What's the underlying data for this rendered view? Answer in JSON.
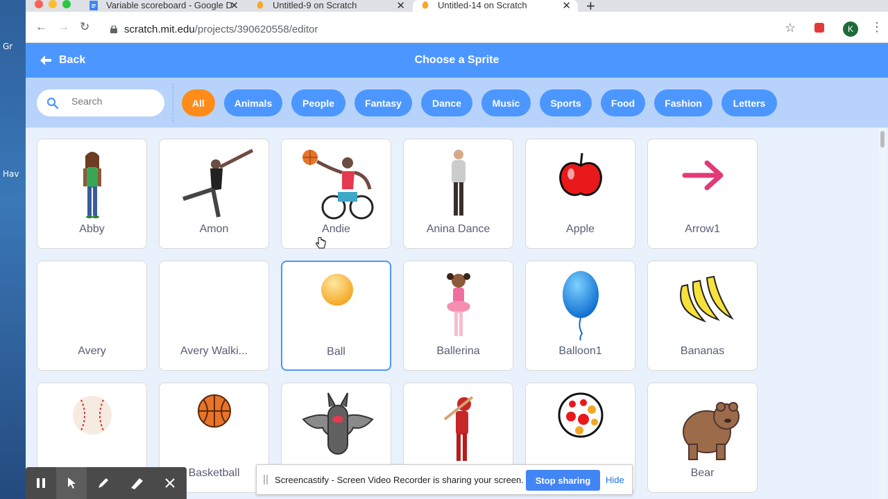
{
  "desktop": {
    "labels": [
      "Gr",
      "Hav"
    ]
  },
  "tabs": [
    {
      "title": "Variable scoreboard - Google D",
      "icon": "google-docs-icon"
    },
    {
      "title": "Untitled-9 on Scratch",
      "icon": "scratch-icon"
    },
    {
      "title": "Untitled-14 on Scratch",
      "icon": "scratch-icon",
      "active": true
    }
  ],
  "address": {
    "host": "scratch.mit.edu",
    "path": "/projects/390620558/editor"
  },
  "profile_initial": "K",
  "modal": {
    "back_label": "Back",
    "title": "Choose a Sprite",
    "search_placeholder": "Search",
    "categories": [
      "All",
      "Animals",
      "People",
      "Fantasy",
      "Dance",
      "Music",
      "Sports",
      "Food",
      "Fashion",
      "Letters"
    ],
    "active_category": "All"
  },
  "sprites": [
    {
      "name": "Abby",
      "icon": "girl-icon"
    },
    {
      "name": "Amon",
      "icon": "dancer-icon"
    },
    {
      "name": "Andie",
      "icon": "wheelchair-basketball-icon"
    },
    {
      "name": "Anina Dance",
      "icon": "dancer-icon"
    },
    {
      "name": "Apple",
      "icon": "apple-icon"
    },
    {
      "name": "Arrow1",
      "icon": "arrow-icon"
    },
    {
      "name": "Avery",
      "icon": "blank-icon"
    },
    {
      "name": "Avery Walki...",
      "icon": "blank-icon"
    },
    {
      "name": "Ball",
      "icon": "ball-icon",
      "selected": true
    },
    {
      "name": "Ballerina",
      "icon": "ballerina-icon"
    },
    {
      "name": "Balloon1",
      "icon": "balloon-icon"
    },
    {
      "name": "Bananas",
      "icon": "bananas-icon"
    },
    {
      "name": "",
      "icon": "baseball-icon"
    },
    {
      "name": "Basketball",
      "icon": "basketball-icon"
    },
    {
      "name": "",
      "icon": "bat-icon"
    },
    {
      "name": "",
      "icon": "batter-icon"
    },
    {
      "name": "",
      "icon": "beachball-icon"
    },
    {
      "name": "Bear",
      "icon": "bear-icon"
    }
  ],
  "screencastify": {
    "message": "Screencastify - Screen Video Recorder is sharing your screen.",
    "stop_label": "Stop sharing",
    "hide_label": "Hide",
    "tools": [
      "pause-icon",
      "pointer-icon",
      "pen-icon",
      "highlighter-icon",
      "close-icon"
    ]
  },
  "colors": {
    "scratch_blue": "#4c97ff",
    "scratch_orange": "#ff8c1a",
    "header_light": "#b7d3fc"
  }
}
